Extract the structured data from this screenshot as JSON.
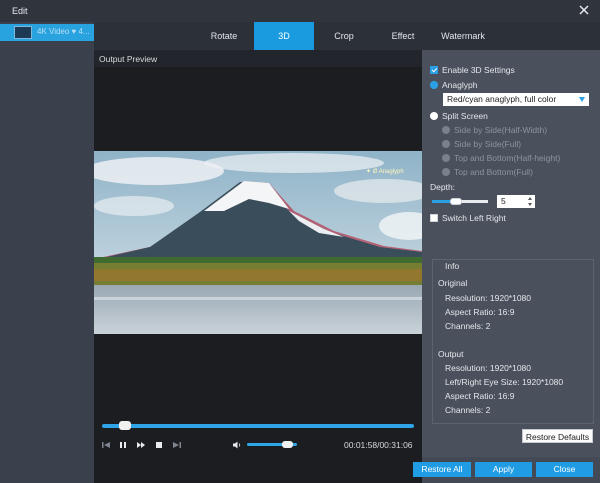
{
  "window": {
    "title": "Edit"
  },
  "sidebar": {
    "items": [
      {
        "label": "4K Video ♥ 4..."
      }
    ]
  },
  "tabs": [
    {
      "label": "Rotate",
      "active": false
    },
    {
      "label": "3D",
      "active": true
    },
    {
      "label": "Crop",
      "active": false
    },
    {
      "label": "Effect",
      "active": false
    },
    {
      "label": "Watermark",
      "active": false
    }
  ],
  "preview": {
    "header": "Output Preview",
    "watermark_text": "✦ Ø Anaglyph",
    "progress_fraction": 0.06,
    "volume_fraction": 0.8,
    "time": "00:01:58/00:31:06"
  },
  "settings": {
    "enable_3d_label": "Enable 3D Settings",
    "enable_3d_checked": true,
    "anaglyph_label": "Anaglyph",
    "anaglyph_selected": true,
    "anaglyph_mode": "Red/cyan anaglyph, full color",
    "split_screen_label": "Split Screen",
    "split_options": [
      "Side by Side(Half-Width)",
      "Side by Side(Full)",
      "Top and Bottom(Half-height)",
      "Top and Bottom(Full)"
    ],
    "depth_label": "Depth:",
    "depth_value": "5",
    "switch_label": "Switch Left Right",
    "switch_checked": false
  },
  "info": {
    "title": "Info",
    "original": {
      "title": "Original",
      "resolution": "Resolution: 1920*1080",
      "aspect": "Aspect Ratio: 16:9",
      "channels": "Channels: 2"
    },
    "output": {
      "title": "Output",
      "resolution": "Resolution: 1920*1080",
      "eye_size": "Left/Right Eye Size: 1920*1080",
      "aspect": "Aspect Ratio: 16:9",
      "channels": "Channels: 2"
    }
  },
  "buttons": {
    "restore_defaults": "Restore Defaults",
    "restore_all": "Restore All",
    "apply": "Apply",
    "close": "Close"
  },
  "colors": {
    "accent": "#1a9be0",
    "titlebar": "#2f343d",
    "panel": "#4a515d"
  }
}
